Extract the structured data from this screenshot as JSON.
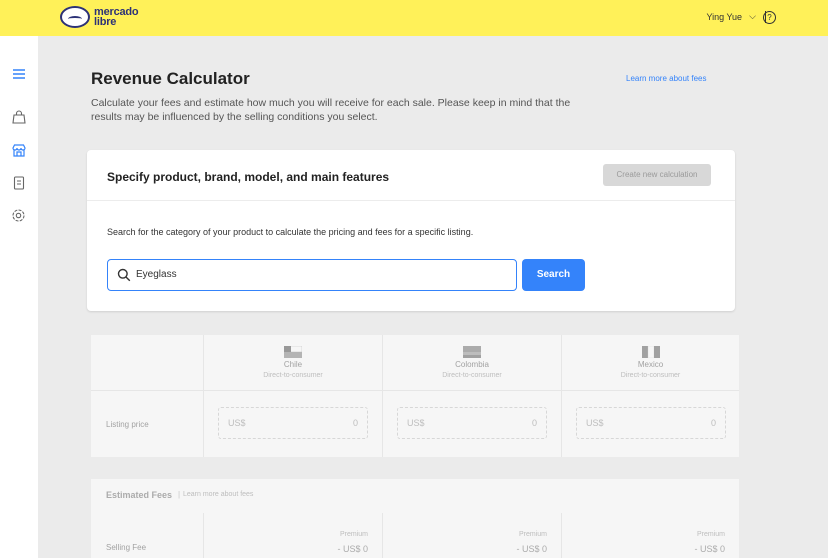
{
  "brand": {
    "line1": "mercado",
    "line2": "libre"
  },
  "topbar": {
    "user_name": "Ying Yue",
    "chevron": "⌵",
    "help_icon": "?"
  },
  "sidebar": {
    "icons": [
      "menu-icon",
      "bag-icon",
      "store-icon",
      "receipt-icon",
      "settings-icon"
    ]
  },
  "header": {
    "title": "Revenue Calculator",
    "learn_link": "Learn more about fees",
    "description": "Calculate your fees and estimate how much you will receive for each sale. Please keep in mind that the results may be influenced by the selling conditions you select."
  },
  "card": {
    "title": "Specify product, brand, model, and main features",
    "new_calc": "Create new calculation",
    "help_text": "Search for the category of your product to calculate the pricing and fees for a specific listing.",
    "search_value": "Eyeglass",
    "search_button": "Search"
  },
  "pricing": {
    "countries": [
      {
        "name": "Chile",
        "sub": "Direct-to-consumer"
      },
      {
        "name": "Colombia",
        "sub": "Direct-to-consumer"
      },
      {
        "name": "Mexico",
        "sub": "Direct-to-consumer"
      }
    ],
    "listing_label": "Listing price",
    "currency": "US$",
    "value": "0"
  },
  "fees": {
    "title": "Estimated Fees",
    "link": "Learn more about fees",
    "selling_label": "Selling Fee",
    "type": "Premium",
    "value": "- US$ 0"
  },
  "colors": {
    "accent": "#3483fa",
    "topbar": "#fff159",
    "brand": "#2d3277"
  }
}
